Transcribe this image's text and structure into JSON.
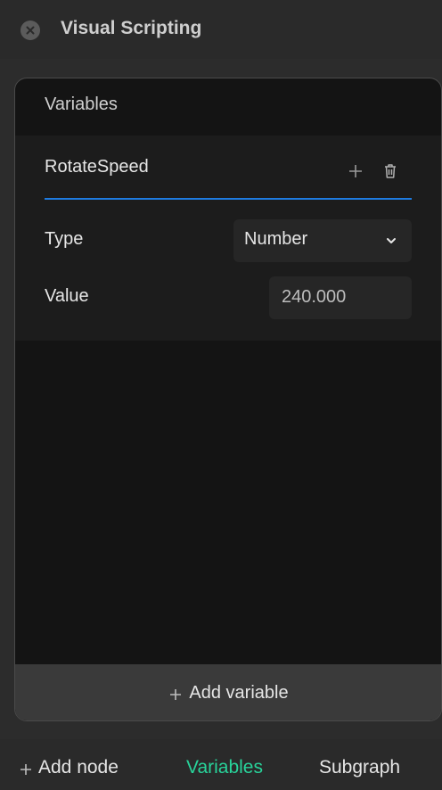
{
  "header": {
    "title": "Visual Scripting",
    "close_icon": "close-icon"
  },
  "panel": {
    "title": "Variables",
    "variable": {
      "name": "RotateSpeed",
      "add_icon": "plus-icon",
      "delete_icon": "trash-icon",
      "type_label": "Type",
      "type_value": "Number",
      "value_label": "Value",
      "value": "240.000"
    },
    "add_variable_label": "Add variable"
  },
  "bottom_tabs": {
    "add_node": "Add node",
    "variables": "Variables",
    "subgraph": "Subgraph"
  },
  "colors": {
    "accent_blue": "#1e7be0",
    "active_tab_green": "#28d39a",
    "background": "#2c2c2c",
    "panel_background": "#141414"
  }
}
